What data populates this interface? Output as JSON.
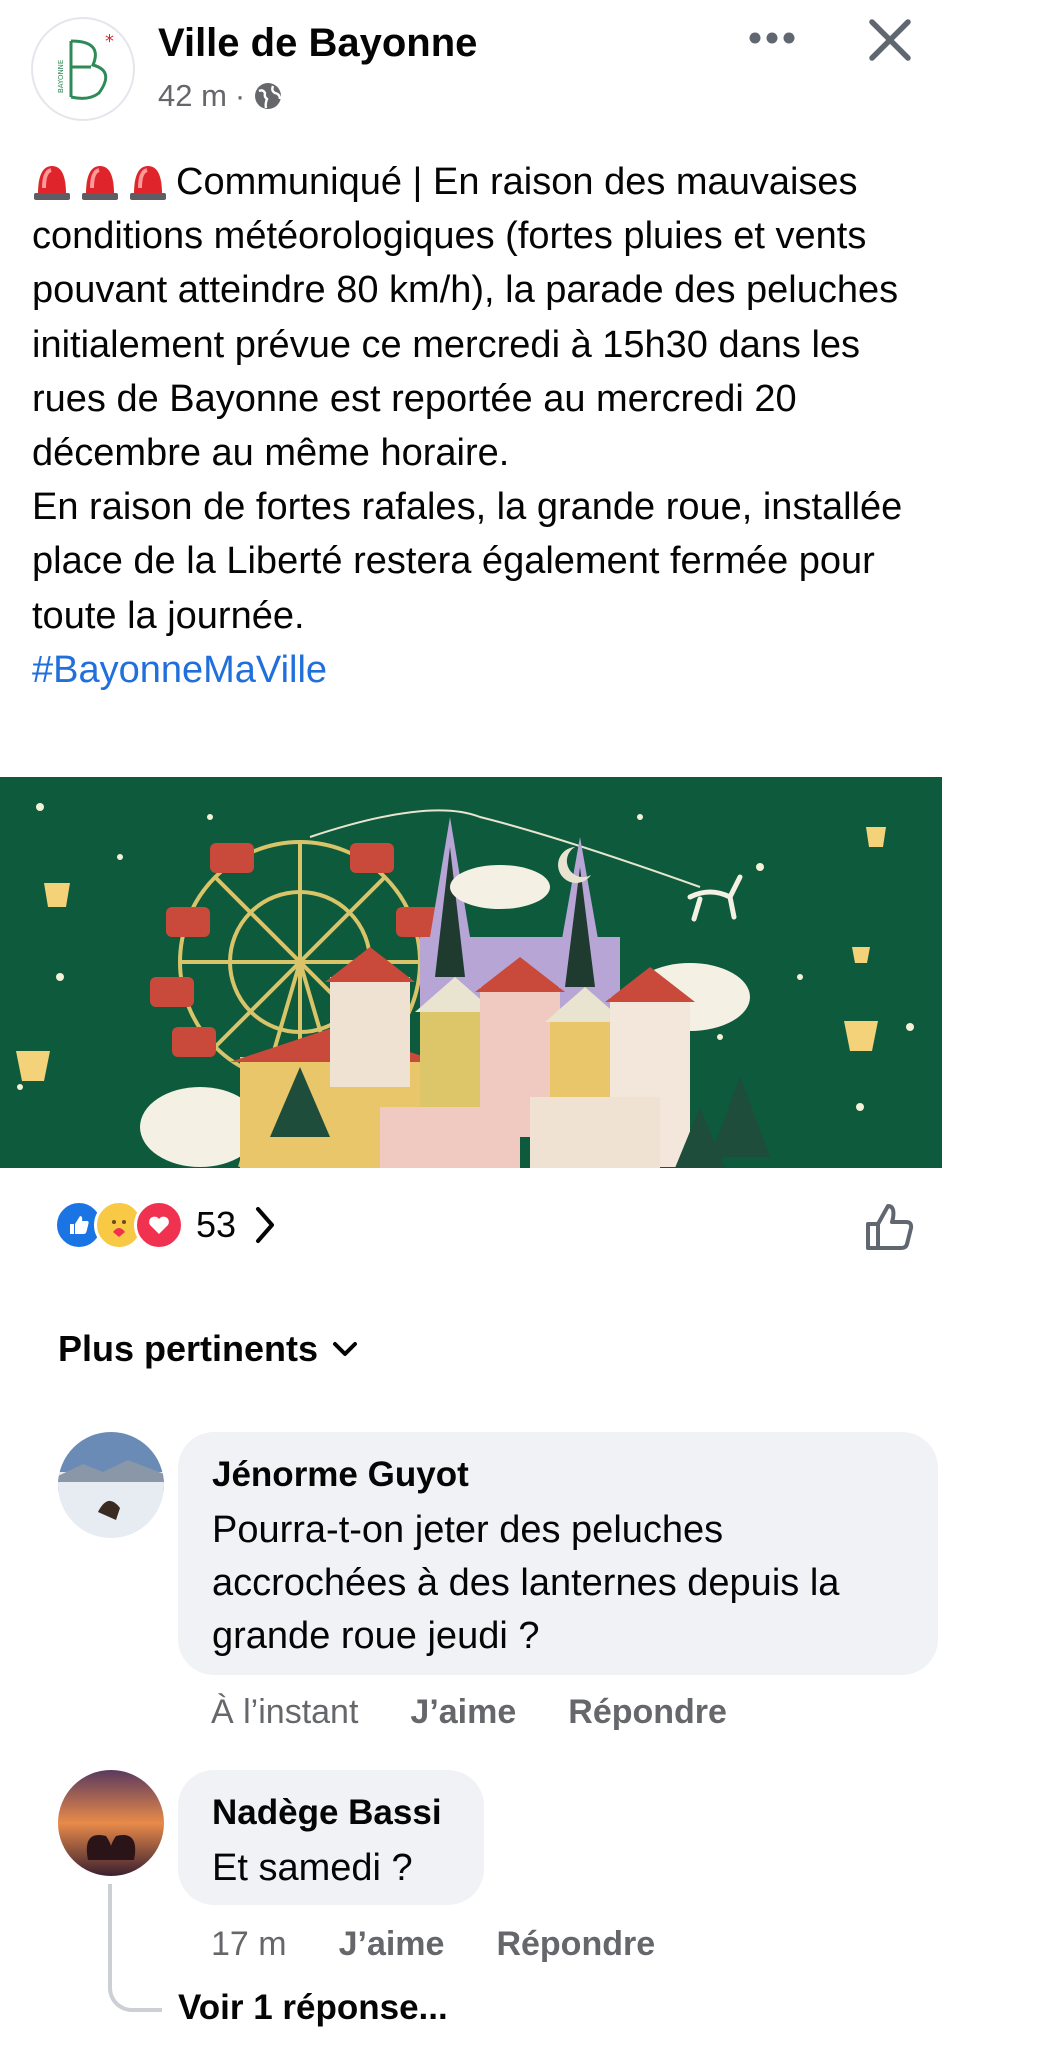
{
  "post": {
    "page_name": "Ville de Bayonne",
    "time": "42 m",
    "separator": "·",
    "audience_icon": "globe-icon",
    "logo_text": "BAYONNE",
    "lead_icons": [
      "siren-icon",
      "siren-icon",
      "siren-icon"
    ],
    "text": "Communiqué | En raison des mauvaises conditions météorologiques (fortes pluies et vents pouvant atteindre 80 km/h), la parade des peluches initialement prévue ce mercredi à 15h30 dans les rues de Bayonne est reportée au mercredi 20 décembre au même horaire.\nEn raison de fortes rafales, la grande roue, installée place de la Liberté restera également fermée pour toute la journée.",
    "hashtag": "#BayonneMaVille",
    "image_alt_icon": "christmas-illustration"
  },
  "reactions": {
    "icons": [
      "like-icon",
      "care-icon",
      "love-icon"
    ],
    "count": "53"
  },
  "sort": {
    "label": "Plus pertinents"
  },
  "comments": [
    {
      "author": "Jénorme Guyot",
      "text": "Pourra-t-on jeter des peluches accrochées à des lanternes depuis la grande roue jeudi ?",
      "time": "À l’instant",
      "like_label": "J’aime",
      "reply_label": "Répondre"
    },
    {
      "author": "Nadège Bassi",
      "text": "Et samedi ?",
      "time": "17 m",
      "like_label": "J’aime",
      "reply_label": "Répondre",
      "view_replies": "Voir 1 réponse..."
    }
  ],
  "colors": {
    "hashtag": "#216fdb",
    "secondary_text": "#65676b",
    "bubble_bg": "#f0f2f5",
    "image_bg": "#0d5a3c",
    "brand_green": "#2e8b57",
    "brand_red": "#d9262e"
  }
}
